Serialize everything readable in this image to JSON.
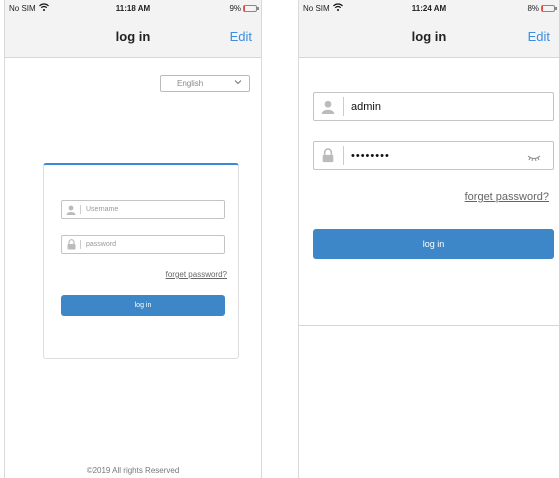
{
  "screen1": {
    "status": {
      "carrier": "No SIM",
      "time": "11:18 AM",
      "battery": "9%",
      "battery_level": 0.09
    },
    "nav": {
      "title": "log in",
      "edit": "Edit"
    },
    "language": {
      "selected": "English"
    },
    "username": {
      "placeholder": "Username"
    },
    "password": {
      "placeholder": "password"
    },
    "forgot": "forget password?",
    "login_button": "log in",
    "footer": "©2019 All rights Reserved"
  },
  "screen2": {
    "status": {
      "carrier": "No SIM",
      "time": "11:24 AM",
      "battery": "8%",
      "battery_level": 0.08
    },
    "nav": {
      "title": "log in",
      "edit": "Edit"
    },
    "username": {
      "value": "admin"
    },
    "password": {
      "masked": "••••••••"
    },
    "forgot": "forget password?",
    "login_button": "log in"
  },
  "icons": {
    "user": "user-icon",
    "lock": "lock-icon",
    "eye": "eye-closed-icon",
    "wifi": "wifi-icon",
    "chevron": "chevron-down-icon"
  },
  "colors": {
    "accent": "#3d86c8",
    "link": "#3a8de0",
    "battery_low": "#e0453d"
  }
}
